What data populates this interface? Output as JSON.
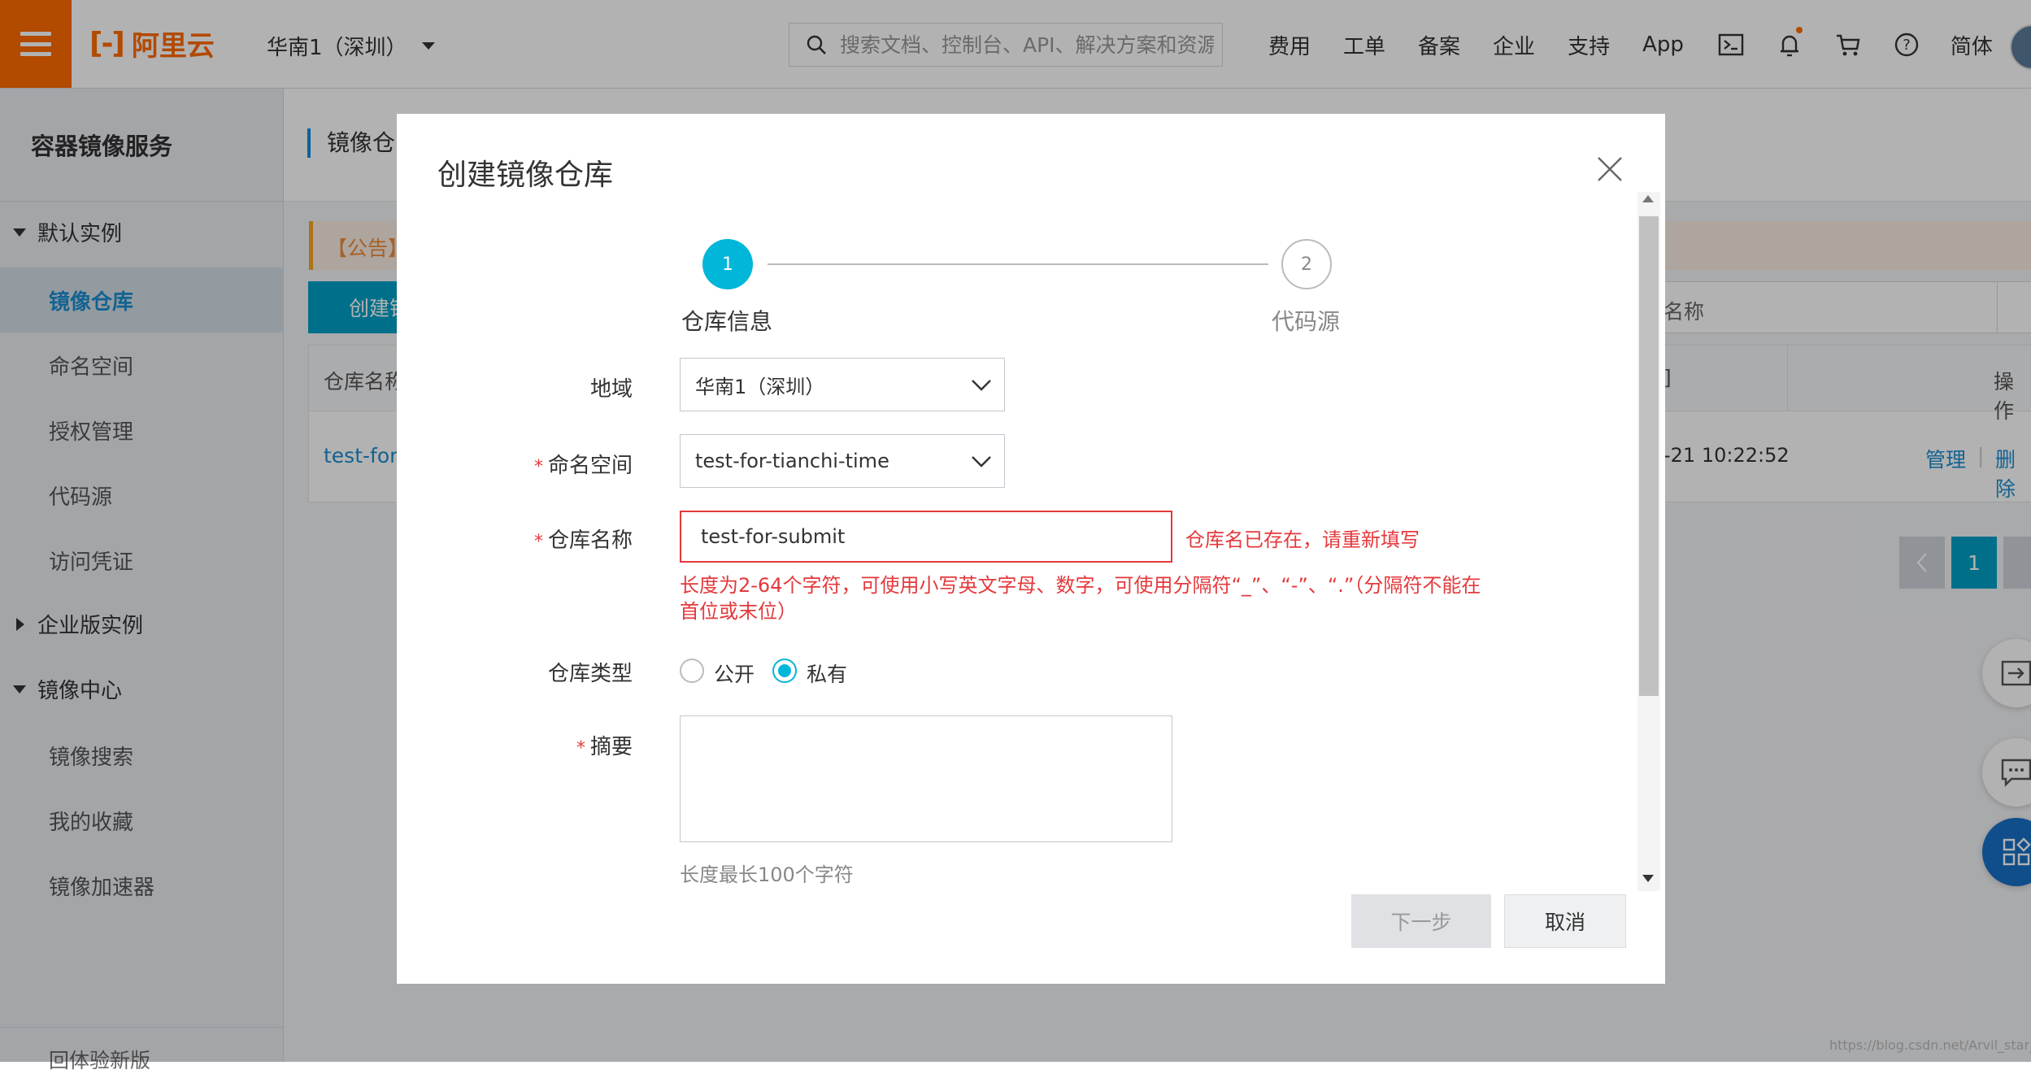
{
  "topbar": {
    "logo_text": "阿里云",
    "region": "华南1（深圳）",
    "search_placeholder": "搜索文档、控制台、API、解决方案和资源",
    "nav": [
      "费用",
      "工单",
      "备案",
      "企业",
      "支持",
      "App"
    ],
    "lang": "简体",
    "icons": [
      "terminal-icon",
      "bell-icon",
      "cart-icon",
      "help-icon"
    ],
    "accent_color": "#ff6a00"
  },
  "sidebar": {
    "title": "容器镜像服务",
    "groups": {
      "default": "默认实例",
      "enterprise": "企业版实例",
      "mirror": "镜像中心"
    },
    "default_items": [
      "镜像仓库",
      "命名空间",
      "授权管理",
      "代码源",
      "访问凭证"
    ],
    "mirror_items": [
      "镜像搜索",
      "我的收藏",
      "镜像加速器"
    ],
    "bottom": "回体验新版"
  },
  "background": {
    "page_title": "镜像仓",
    "notice": "【公告】",
    "create_btn": "创建镜",
    "search_placeholder": "名称",
    "col_name": "仓库名称",
    "col_time": "]",
    "col_op": "操作",
    "repo_link": "test-for-s",
    "time": "-21 10:22:52",
    "manage": "管理",
    "pipe": "|",
    "delete": "删除",
    "page": "1",
    "watermark": "https://blog.csdn.net/Arvil_star_liu"
  },
  "modal": {
    "title": "创建镜像仓库",
    "steps": [
      {
        "num": "1",
        "label": "仓库信息"
      },
      {
        "num": "2",
        "label": "代码源"
      }
    ],
    "region_label": "地域",
    "region_value": "华南1（深圳）",
    "namespace_label": "命名空间",
    "namespace_value": "test-for-tianchi-time",
    "name_label": "仓库名称",
    "name_value": "test-for-submit",
    "name_error": "仓库名已存在，请重新填写",
    "name_hint": "长度为2-64个字符，可使用小写英文字母、数字，可使用分隔符“_”、“-”、“.”（分隔符不能在首位或末位）",
    "type_label": "仓库类型",
    "type_public": "公开",
    "type_private": "私有",
    "selected_type": "私有",
    "summary_label": "摘要",
    "summary_hint": "长度最长100个字符",
    "required_mark": "*",
    "next_btn": "下一步",
    "cancel_btn": "取消",
    "step_color": "#00b6d9",
    "error_color": "#e4393c"
  }
}
